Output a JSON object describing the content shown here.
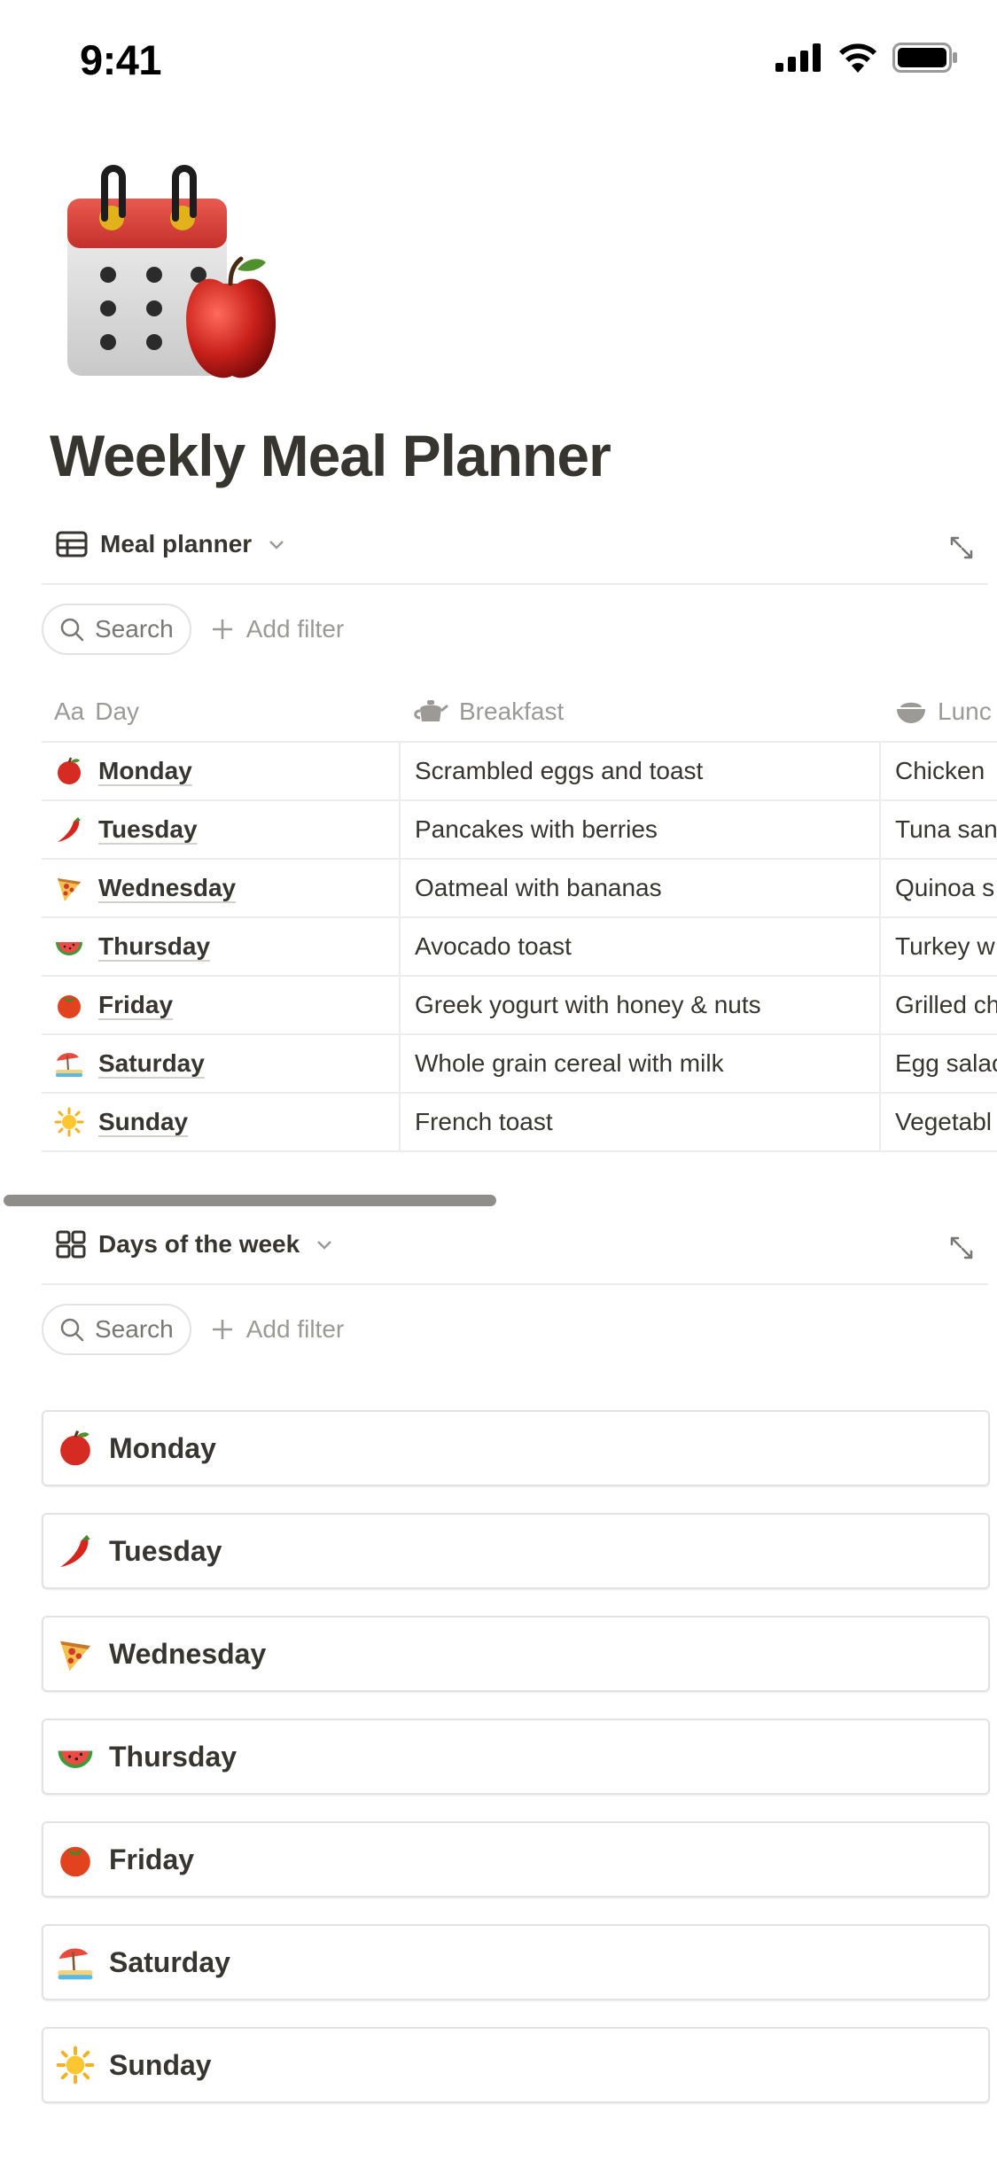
{
  "status_bar": {
    "time": "9:41"
  },
  "page": {
    "title": "Weekly Meal Planner",
    "icon": "calendar-apple-icon"
  },
  "table_view": {
    "title": "Meal planner",
    "search_label": "Search",
    "add_filter_label": "Add filter",
    "columns": {
      "day": "Day",
      "breakfast": "Breakfast",
      "lunch": "Lunc"
    },
    "rows": [
      {
        "day": "Monday",
        "emoji": "apple",
        "breakfast": "Scrambled eggs and toast",
        "lunch": "Chicken"
      },
      {
        "day": "Tuesday",
        "emoji": "chili-pepper",
        "breakfast": "Pancakes with berries",
        "lunch": "Tuna san"
      },
      {
        "day": "Wednesday",
        "emoji": "pizza",
        "breakfast": "Oatmeal with bananas",
        "lunch": "Quinoa s"
      },
      {
        "day": "Thursday",
        "emoji": "watermelon",
        "breakfast": "Avocado toast",
        "lunch": "Turkey w"
      },
      {
        "day": "Friday",
        "emoji": "tomato",
        "breakfast": "Greek yogurt with honey & nuts",
        "lunch": "Grilled ch"
      },
      {
        "day": "Saturday",
        "emoji": "beach-umbrella",
        "breakfast": "Whole grain cereal with milk",
        "lunch": "Egg salac"
      },
      {
        "day": "Sunday",
        "emoji": "sun",
        "breakfast": "French toast",
        "lunch": "Vegetabl"
      }
    ]
  },
  "gallery_view": {
    "title": "Days of the week",
    "search_label": "Search",
    "add_filter_label": "Add filter",
    "items": [
      {
        "label": "Monday",
        "emoji": "apple"
      },
      {
        "label": "Tuesday",
        "emoji": "chili-pepper"
      },
      {
        "label": "Wednesday",
        "emoji": "pizza"
      },
      {
        "label": "Thursday",
        "emoji": "watermelon"
      },
      {
        "label": "Friday",
        "emoji": "tomato"
      },
      {
        "label": "Saturday",
        "emoji": "beach-umbrella"
      },
      {
        "label": "Sunday",
        "emoji": "sun"
      }
    ]
  }
}
